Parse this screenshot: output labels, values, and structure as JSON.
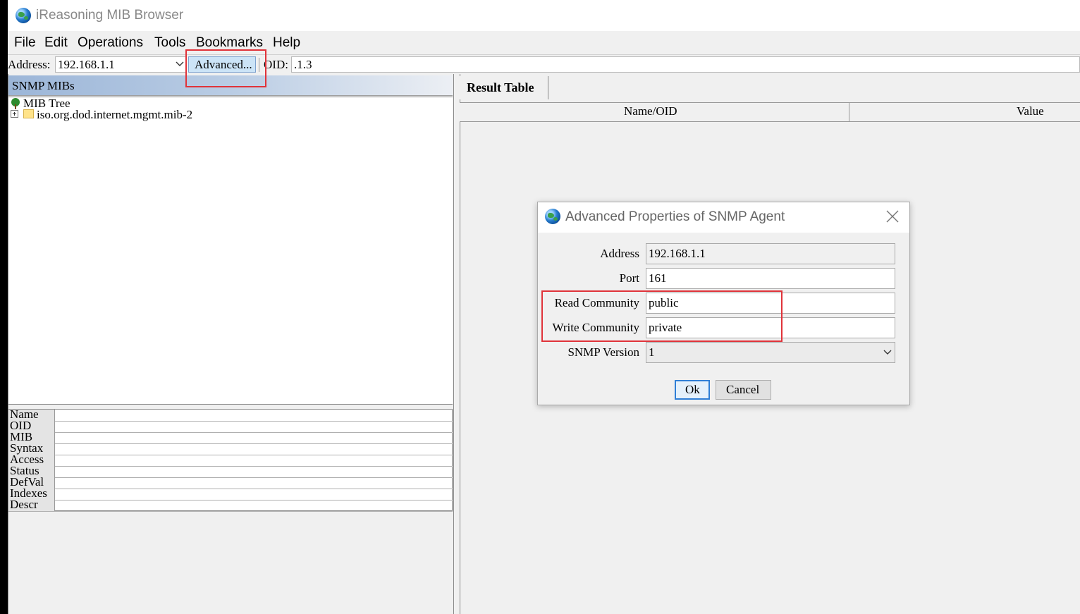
{
  "window": {
    "title": "iReasoning MIB Browser"
  },
  "menu": {
    "items": [
      "File",
      "Edit",
      "Operations",
      "Tools",
      "Bookmarks",
      "Help"
    ]
  },
  "toolbar": {
    "address_label": "Address:",
    "address_value": "192.168.1.1",
    "advanced_label": "Advanced...",
    "oid_label": "OID:",
    "oid_value": ".1.3"
  },
  "left_panel": {
    "header": "SNMP MIBs",
    "tree": {
      "root": "MIB Tree",
      "child": "iso.org.dod.internet.mgmt.mib-2"
    },
    "properties": [
      "Name",
      "OID",
      "MIB",
      "Syntax",
      "Access",
      "Status",
      "DefVal",
      "Indexes",
      "Descr"
    ]
  },
  "right_panel": {
    "tab": "Result Table",
    "columns": [
      "Name/OID",
      "Value"
    ]
  },
  "dialog": {
    "title": "Advanced Properties of SNMP Agent",
    "fields": [
      {
        "label": "Address",
        "value": "192.168.1.1"
      },
      {
        "label": "Port",
        "value": "161"
      },
      {
        "label": "Read Community",
        "value": "public"
      },
      {
        "label": "Write Community",
        "value": "private"
      },
      {
        "label": "SNMP Version",
        "value": "1"
      }
    ],
    "ok_label": "Ok",
    "cancel_label": "Cancel"
  },
  "colors": {
    "highlight": "#e0333a",
    "accent": "#2f7fd6"
  },
  "icons": [
    "globe-icon",
    "chevron-down-icon",
    "tree-icon",
    "expand-icon",
    "folder-icon",
    "close-icon"
  ]
}
